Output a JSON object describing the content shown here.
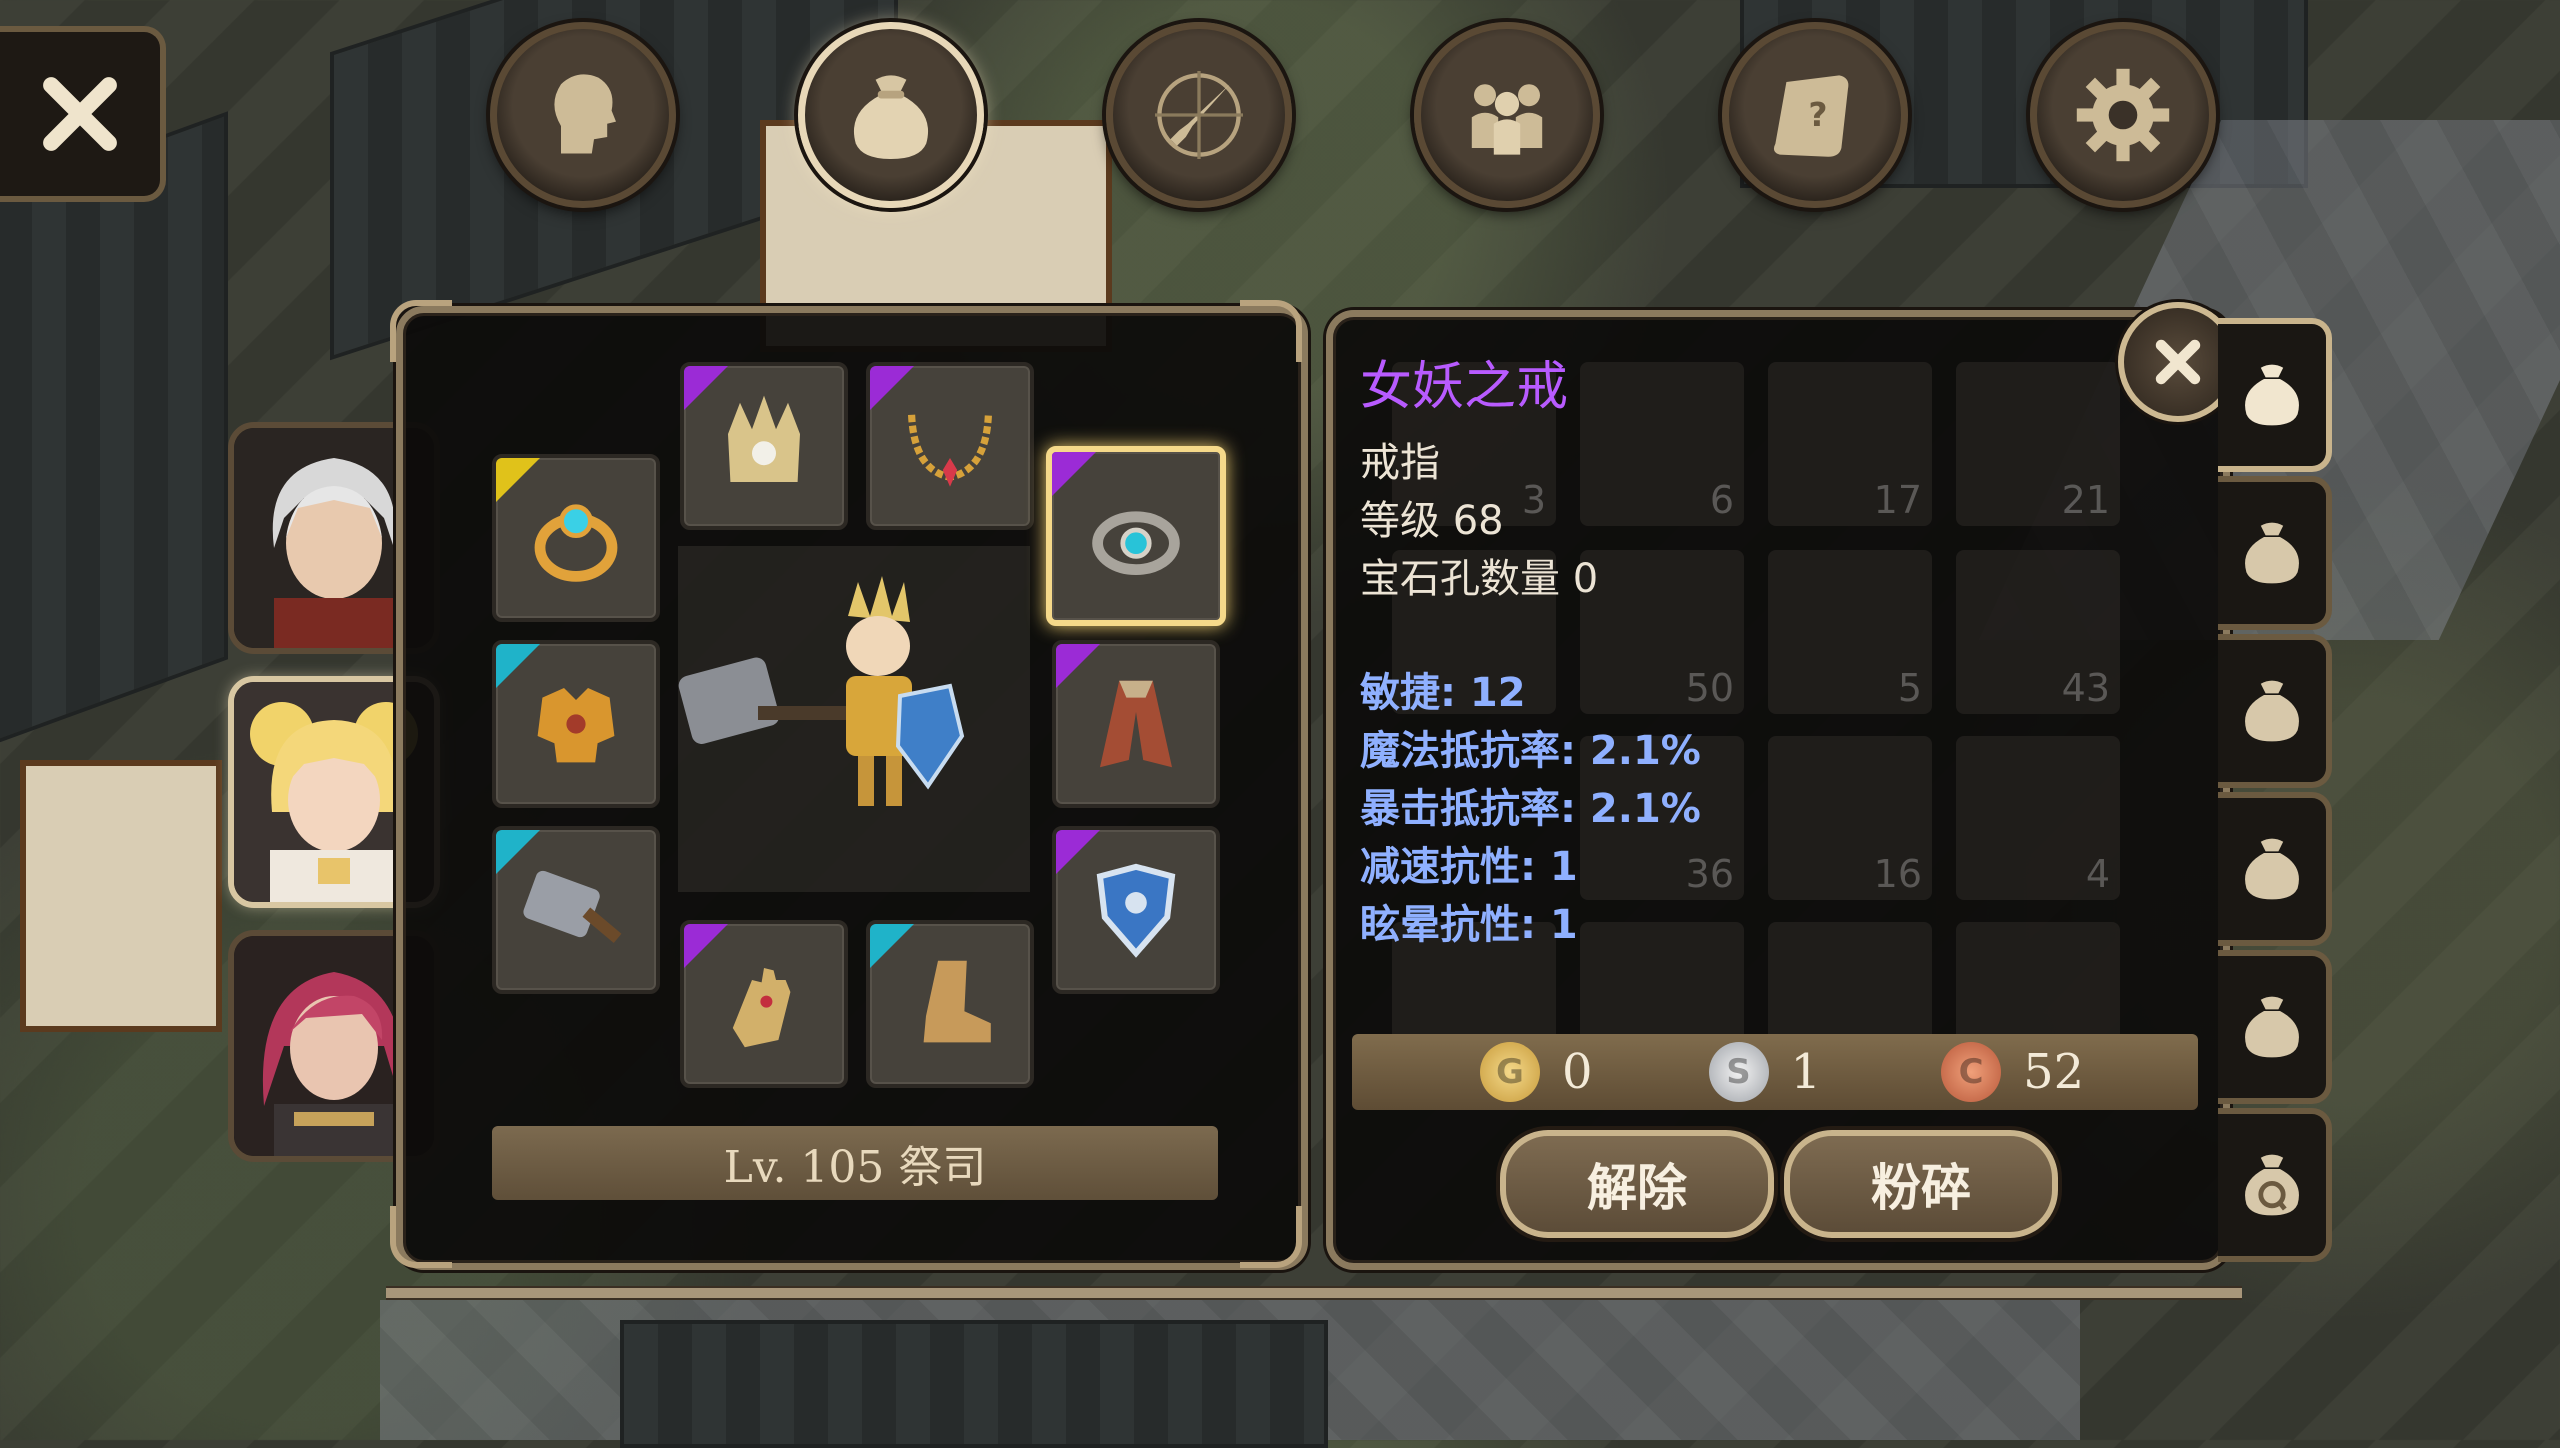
{
  "top_nav": {
    "tabs": [
      {
        "name": "character",
        "icon": "head-icon",
        "active": false
      },
      {
        "name": "inventory",
        "icon": "bag-icon",
        "active": true
      },
      {
        "name": "skills",
        "icon": "compass-sword-icon",
        "active": false
      },
      {
        "name": "party",
        "icon": "group-icon",
        "active": false
      },
      {
        "name": "quests",
        "icon": "scroll-icon",
        "active": false
      },
      {
        "name": "settings",
        "icon": "gear-icon",
        "active": false
      }
    ]
  },
  "character_panel": {
    "level_class": "Lv. 105 祭司",
    "portraits": [
      {
        "name": "white-haired-hero",
        "active": false
      },
      {
        "name": "blonde-priestess",
        "active": true
      },
      {
        "name": "red-haired-warrior",
        "active": false
      }
    ],
    "equipment": [
      {
        "slot": "helmet",
        "icon": "crown-helmet-icon",
        "rarity": "purple"
      },
      {
        "slot": "necklace",
        "icon": "necklace-icon",
        "rarity": "purple"
      },
      {
        "slot": "ring-left",
        "icon": "gold-ring-icon",
        "rarity": "yellow"
      },
      {
        "slot": "ring-right",
        "icon": "silver-ring-icon",
        "rarity": "purple",
        "selected": true
      },
      {
        "slot": "armor",
        "icon": "chest-armor-icon",
        "rarity": "cyan"
      },
      {
        "slot": "cloak",
        "icon": "cloak-icon",
        "rarity": "purple"
      },
      {
        "slot": "weapon",
        "icon": "hammer-icon",
        "rarity": "cyan"
      },
      {
        "slot": "shield",
        "icon": "shield-icon",
        "rarity": "purple"
      },
      {
        "slot": "gloves",
        "icon": "gauntlet-icon",
        "rarity": "purple"
      },
      {
        "slot": "boots",
        "icon": "boot-icon",
        "rarity": "cyan"
      }
    ]
  },
  "item_detail": {
    "name": "女妖之戒",
    "type": "戒指",
    "level": "等级 68",
    "sockets": "宝石孔数量 0",
    "stats": [
      "敏捷: 12",
      "魔法抵抗率: 2.1%",
      "暴击抵抗率: 2.1%",
      "减速抗性: 1",
      "眩晕抗性: 1"
    ],
    "currency": {
      "gold": "0",
      "silver": "1",
      "copper": "52"
    },
    "buttons": {
      "unequip": "解除",
      "shatter": "粉碎"
    }
  },
  "background_bag": {
    "counts": [
      "3",
      "6",
      "17",
      "21",
      "50",
      "5",
      "43",
      "36",
      "16",
      "4"
    ]
  },
  "colors": {
    "rarity_purple": "#9b2bd6",
    "rarity_cyan": "#1fb3c9",
    "rarity_yellow": "#e0c21a",
    "item_name": "#b85bff",
    "stat_text": "#8fb0ff"
  }
}
